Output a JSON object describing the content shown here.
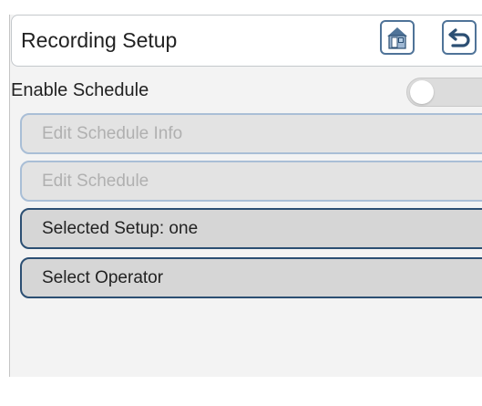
{
  "header": {
    "title": "Recording Setup",
    "settings_icon": "kiosk-settings-icon",
    "back_icon": "back-arrow-icon"
  },
  "schedule": {
    "label": "Enable Schedule",
    "enabled": false
  },
  "menu": {
    "edit_schedule_info": "Edit Schedule Info",
    "edit_schedule": "Edit Schedule",
    "selected_setup": "Selected Setup: one",
    "select_operator": "Select Operator"
  },
  "colors": {
    "accent_border": "#2c4f73",
    "disabled_border": "#a9bed6",
    "icon_blue": "#4f7398"
  }
}
